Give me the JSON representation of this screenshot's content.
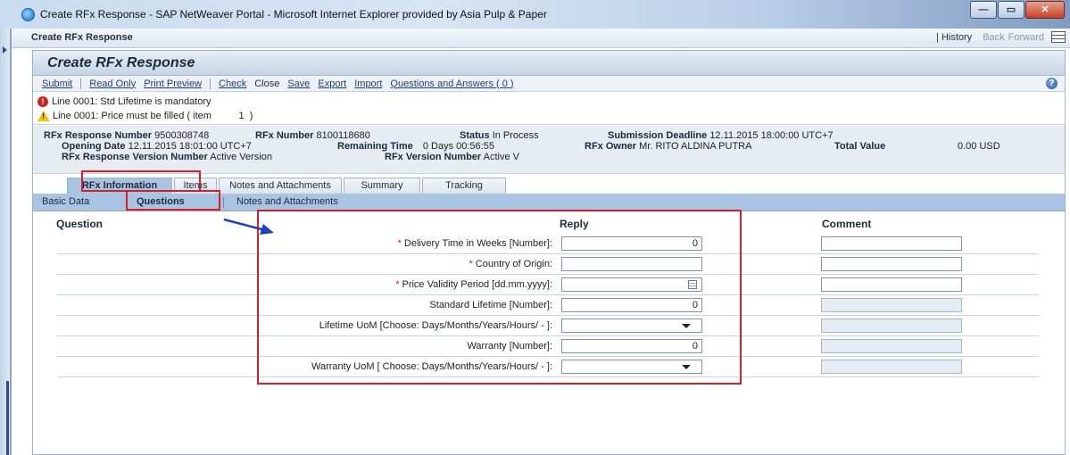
{
  "window": {
    "title": "Create RFx Response - SAP NetWeaver Portal - Microsoft Internet Explorer provided by Asia Pulp & Paper"
  },
  "portal": {
    "title": "Create RFx Response",
    "history": "| History",
    "back": "Back",
    "forward": "Forward"
  },
  "app": {
    "title": "Create RFx Response",
    "toolbar": {
      "submit": "Submit",
      "read_only": "Read Only",
      "print_preview": "Print Preview",
      "check": "Check",
      "close": "Close",
      "save": "Save",
      "export": "Export",
      "import": "Import",
      "qa": "Questions and Answers ( 0 )"
    },
    "messages": [
      {
        "type": "error",
        "text": "Line 0001: Std Lifetime is mandatory"
      },
      {
        "type": "warning",
        "text": "Line 0001: Price must be filled ( item          1  )"
      }
    ],
    "header": {
      "response_number_label": "RFx Response Number",
      "response_number": "9500308748",
      "rfx_number_label": "RFx Number",
      "rfx_number": "8100118680",
      "status_label": "Status",
      "status": "In Process",
      "deadline_label": "Submission Deadline",
      "deadline": "12.11.2015 18:00:00 UTC+7",
      "opening_label": "Opening Date",
      "opening": "12.11.2015 18:01:00 UTC+7",
      "remaining_label": "Remaining Time",
      "remaining": "0 Days 00:56:55",
      "owner_label": "RFx Owner",
      "owner": "Mr. RITO ALDINA PUTRA",
      "total_label": "Total Value",
      "total": "0.00 USD",
      "resp_version_label": "RFx Response Version Number",
      "resp_version": "Active Version",
      "rfx_version_label": "RFx Version Number",
      "rfx_version": "Active V"
    },
    "tabs": [
      "RFx Information",
      "Items",
      "Notes and Attachments",
      "Summary",
      "Tracking"
    ],
    "subtabs": [
      "Basic Data",
      "Questions",
      "Notes and Attachments"
    ],
    "columns": {
      "question": "Question",
      "reply": "Reply",
      "comment": "Comment"
    },
    "questions": [
      {
        "label": "Delivery Time in Weeks [Number]:",
        "required": "*",
        "value": "0"
      },
      {
        "label": "Country of Origin:",
        "required": "*",
        "value": ""
      },
      {
        "label": "Price Validity Period [dd.mm.yyyy]:",
        "required": "*",
        "value": ""
      },
      {
        "label": "Standard Lifetime [Number]:",
        "required": "",
        "value": "0"
      },
      {
        "label": "Lifetime UoM [Choose: Days/Months/Years/Hours/ - ]:",
        "required": "",
        "value": ""
      },
      {
        "label": "Warranty [Number]:",
        "required": "",
        "value": "0"
      },
      {
        "label": "Warranty UoM [ Choose: Days/Months/Years/Hours/ - ]:",
        "required": "",
        "value": ""
      }
    ],
    "colors": {
      "tab_active": "#a9c4e2",
      "annotation_red": "#d61f26",
      "annotation_blue": "#1f3fbf"
    }
  }
}
